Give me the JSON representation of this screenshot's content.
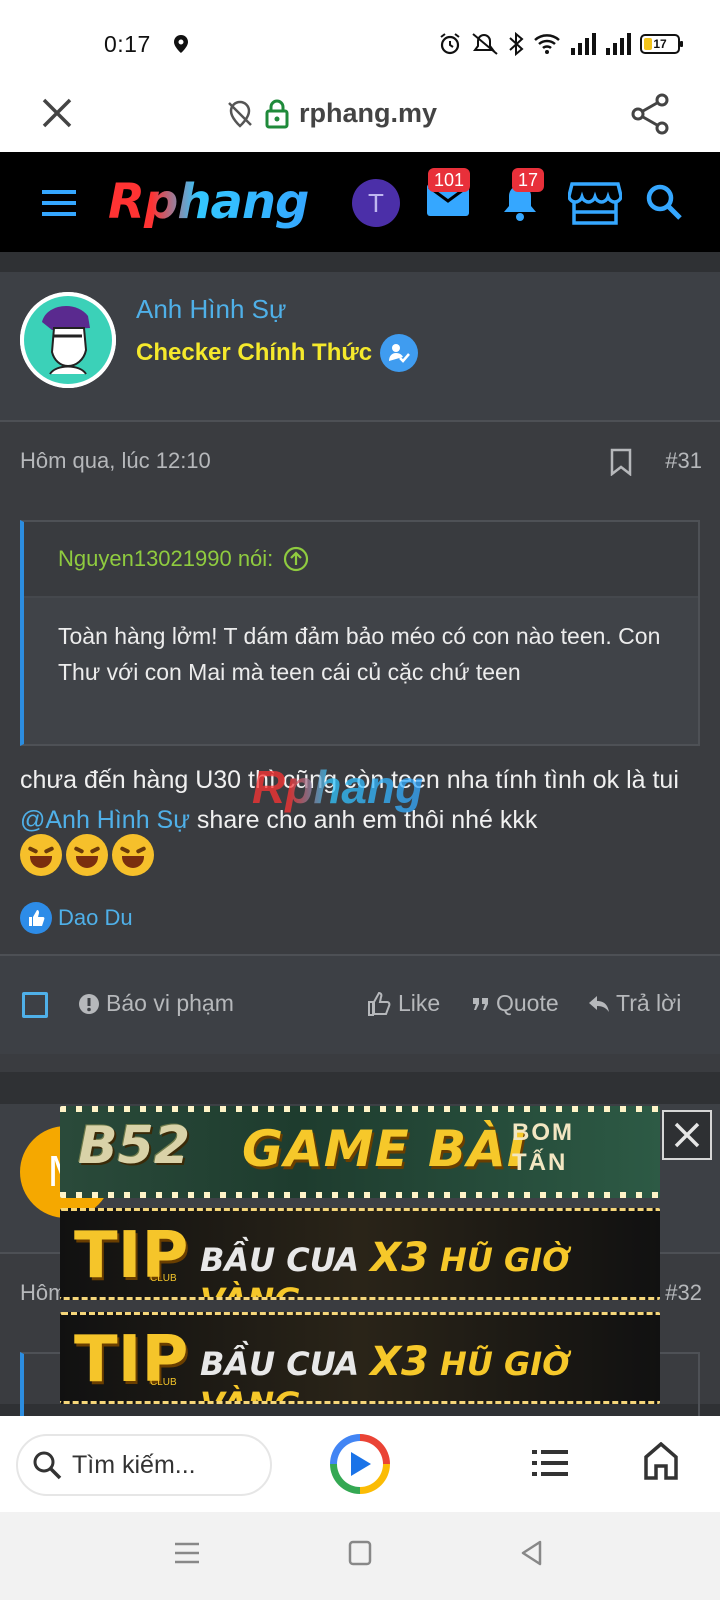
{
  "status_bar": {
    "time": "0:17",
    "battery": "17",
    "icons": [
      "location-icon",
      "alarm-icon",
      "mute-icon",
      "bluetooth-icon",
      "wifi-icon",
      "signal-icon",
      "signal-icon-2",
      "battery-icon"
    ]
  },
  "url_bar": {
    "url": "rphang.my",
    "icons": [
      "close-icon",
      "tracking-off-icon",
      "lock-icon",
      "share-icon"
    ]
  },
  "site_header": {
    "logo": "Rphang",
    "avatar_letter": "T",
    "messages_badge": "101",
    "alerts_badge": "17",
    "icons": [
      "menu-icon",
      "mail-icon",
      "bell-icon",
      "store-icon",
      "search-icon"
    ]
  },
  "post": {
    "username": "Anh Hình Sự",
    "user_title": "Checker Chính Thức",
    "time": "Hôm qua, lúc 12:10",
    "post_number": "#31",
    "quote": {
      "author": "Nguyen13021990 nói:",
      "text": "Toàn hàng lởm! T dám đảm bảo méo có con nào teen. Con Thư với con Mai mà teen cái củ cặc chứ teen"
    },
    "body_before": "chưa đến hàng U30 thì cũng còn teen nha tính tình ok là tui ",
    "mention": "@Anh Hình Sự",
    "body_after": " share cho anh em thôi nhé kkk",
    "emojis": [
      "rofl",
      "rofl",
      "rofl"
    ],
    "liked_by": "Dao Du",
    "watermark": "Rphang",
    "actions": {
      "report": "Báo vi phạm",
      "like": "Like",
      "quote": "Quote",
      "reply": "Trả lời"
    }
  },
  "post2": {
    "avatar_letter": "M",
    "time_partial": "Hôm",
    "post_number": "#32"
  },
  "ads": {
    "ad1": {
      "brand": "B52",
      "headline": "GAME BÀI",
      "tag_line1": "BOM",
      "tag_line2": "TẤN"
    },
    "ad2": {
      "brand": "TIP",
      "club": "CLUB",
      "text1": "BẦU CUA",
      "x3": "X3",
      "text2": "HŨ GIỜ VÀNG"
    },
    "ad3": {
      "brand": "TIP",
      "club": "CLUB",
      "text1": "BẦU CUA",
      "x3": "X3",
      "text2": "HŨ GIỜ VÀNG"
    }
  },
  "bottom_bar": {
    "search_placeholder": "Tìm kiếm..."
  },
  "colors": {
    "accent_blue": "#4fb0e8",
    "title_yellow": "#f5e92c",
    "quote_green": "#8fcb3f",
    "badge_red": "#e8303a"
  }
}
